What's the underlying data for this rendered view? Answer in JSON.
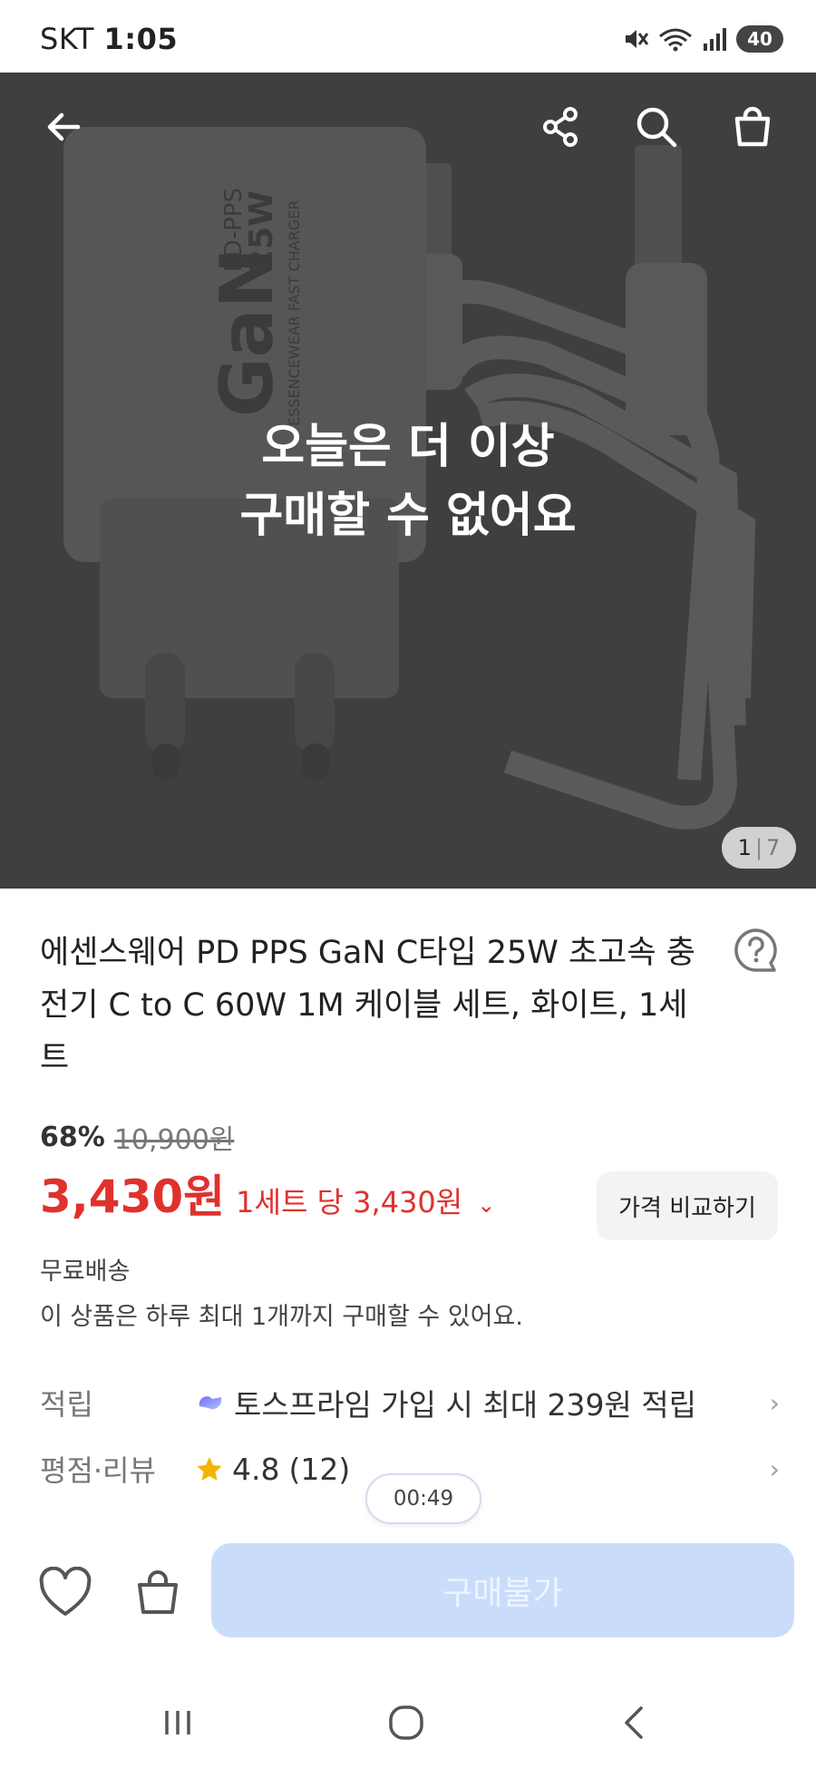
{
  "status_bar": {
    "carrier": "SKT",
    "time": "1:05",
    "battery": "40"
  },
  "hero": {
    "overlay_line1": "오늘은 더 이상",
    "overlay_line2": "구매할 수 없어요",
    "page_current": "1",
    "page_total": "7",
    "product_text_brand": "GaN",
    "product_text_spec1": "PD-PPS",
    "product_text_spec2": "25W",
    "product_text_sub": "ESSENCEWEAR FAST CHARGER",
    "icons": [
      "back-arrow-icon",
      "share-icon",
      "search-icon",
      "shopping-bag-icon"
    ]
  },
  "product": {
    "title": "에센스웨어 PD PPS GaN C타입 25W 초고속 충전기 C to C 60W 1M 케이블 세트, 화이트, 1세트",
    "discount_percent": "68%",
    "original_price": "10,900원",
    "price": "3,430원",
    "unit_price": "1세트 당 3,430원",
    "compare_button": "가격 비교하기",
    "shipping": "무료배송",
    "limit_note": "이 상품은 하루 최대 1개까지 구매할 수 있어요."
  },
  "rows": {
    "points_label": "적립",
    "points_value": "토스프라임 가입 시 최대 239원 적립",
    "review_label": "평점·리뷰",
    "rating": "4.8",
    "review_count": "(12)"
  },
  "timer": "00:49",
  "bottom_bar": {
    "buy_button": "구매불가"
  },
  "colors": {
    "price_red": "#e0312d",
    "buy_disabled_bg": "#c9ddfb",
    "hero_bg": "#3f3f3f",
    "star": "#f5b400"
  }
}
